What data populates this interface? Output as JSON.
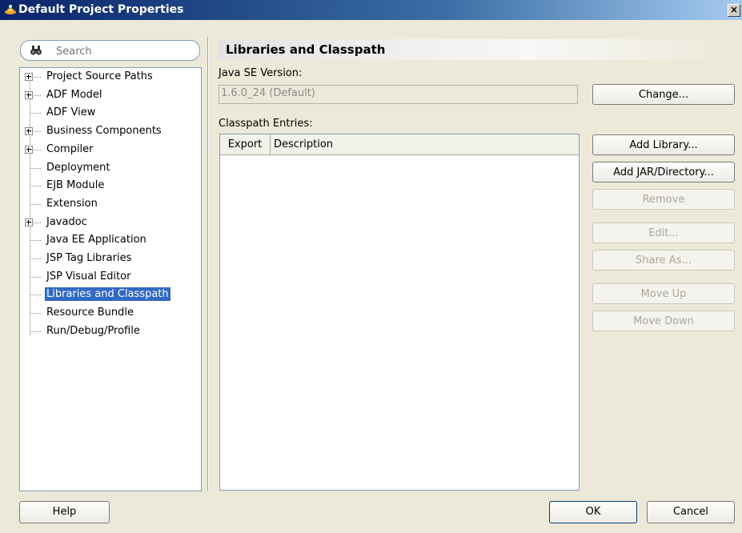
{
  "window": {
    "title": "Default Project Properties",
    "close_label": "×"
  },
  "search": {
    "placeholder": "Search"
  },
  "tree": {
    "items": [
      {
        "label": "Project Source Paths",
        "expandable": true
      },
      {
        "label": "ADF Model",
        "expandable": true
      },
      {
        "label": "ADF View",
        "expandable": false
      },
      {
        "label": "Business Components",
        "expandable": true
      },
      {
        "label": "Compiler",
        "expandable": true
      },
      {
        "label": "Deployment",
        "expandable": false
      },
      {
        "label": "EJB Module",
        "expandable": false
      },
      {
        "label": "Extension",
        "expandable": false
      },
      {
        "label": "Javadoc",
        "expandable": true
      },
      {
        "label": "Java EE Application",
        "expandable": false
      },
      {
        "label": "JSP Tag Libraries",
        "expandable": false
      },
      {
        "label": "JSP Visual Editor",
        "expandable": false
      },
      {
        "label": "Libraries and Classpath",
        "expandable": false,
        "selected": true
      },
      {
        "label": "Resource Bundle",
        "expandable": false
      },
      {
        "label": "Run/Debug/Profile",
        "expandable": false
      }
    ]
  },
  "panel": {
    "heading": "Libraries and Classpath",
    "java_se_label": "Java SE Version:",
    "java_se_value": "1.6.0_24 (Default)",
    "classpath_label": "Classpath Entries:",
    "columns": {
      "export": "Export",
      "description": "Description"
    }
  },
  "buttons": {
    "change": "Change...",
    "add_library": "Add Library...",
    "add_jar": "Add JAR/Directory...",
    "remove": "Remove",
    "edit": "Edit...",
    "share_as": "Share As...",
    "move_up": "Move Up",
    "move_down": "Move Down",
    "help": "Help",
    "ok": "OK",
    "cancel": "Cancel"
  }
}
